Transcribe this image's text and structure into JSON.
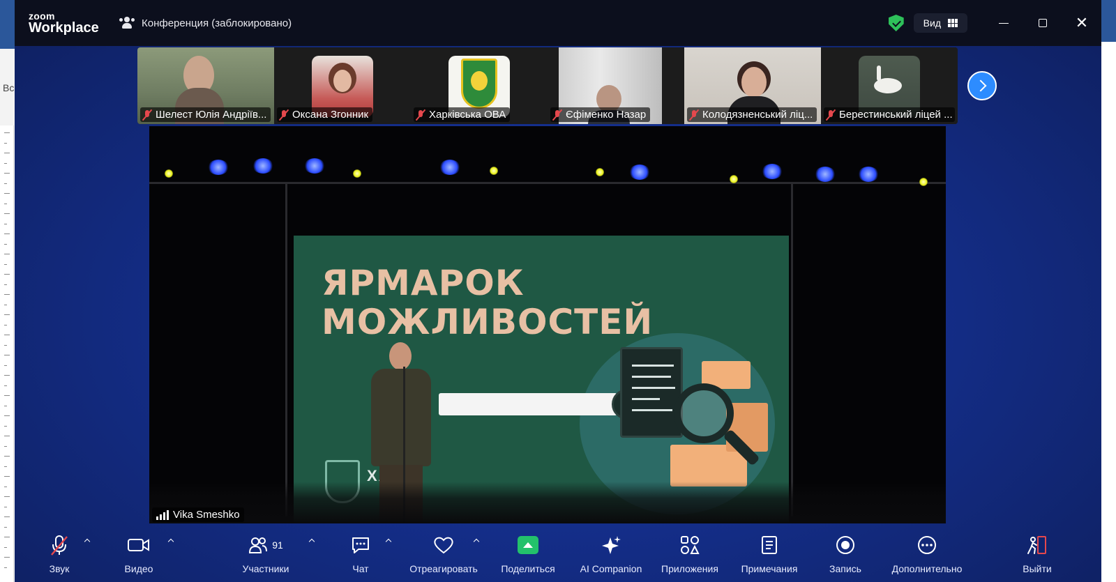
{
  "background_app": {
    "left_text": "Вс"
  },
  "window": {
    "brand_top": "zoom",
    "brand_bottom": "Workplace",
    "meeting_title": "Конференция (заблокировано)",
    "view_label": "Вид",
    "security_color": "#2ec05a"
  },
  "participants": [
    {
      "name": "Шелест Юлія Андріїв...",
      "muted": true
    },
    {
      "name": "Оксана Згонник",
      "muted": true
    },
    {
      "name": "Харківська ОВА",
      "muted": true
    },
    {
      "name": "Єфіменко Назар",
      "muted": true
    },
    {
      "name": "Колодязненський ліц...",
      "muted": true
    },
    {
      "name": "Берестинський ліцей ...",
      "muted": true
    }
  ],
  "speaker": {
    "name": "Vika Smeshko",
    "slide_title_line1": "ЯРМАРОК",
    "slide_title_line2": "МОЖЛИВОСТЕЙ",
    "slide_logo_text": "ХА"
  },
  "toolbar": {
    "audio": "Звук",
    "video": "Видео",
    "participants": "Участники",
    "participants_count": "91",
    "chat": "Чат",
    "react": "Отреагировать",
    "share": "Поделиться",
    "ai_companion": "AI Companion",
    "apps": "Приложения",
    "notes": "Примечания",
    "record": "Запись",
    "more": "Дополнительно",
    "leave": "Выйти"
  },
  "colors": {
    "titlebar": "#0c0f1d",
    "window_bg": "#142e8a",
    "accent_blue": "#2d8cff",
    "share_green": "#23c16b",
    "mute_red": "#e5484d",
    "leave_red": "#e5484d"
  }
}
